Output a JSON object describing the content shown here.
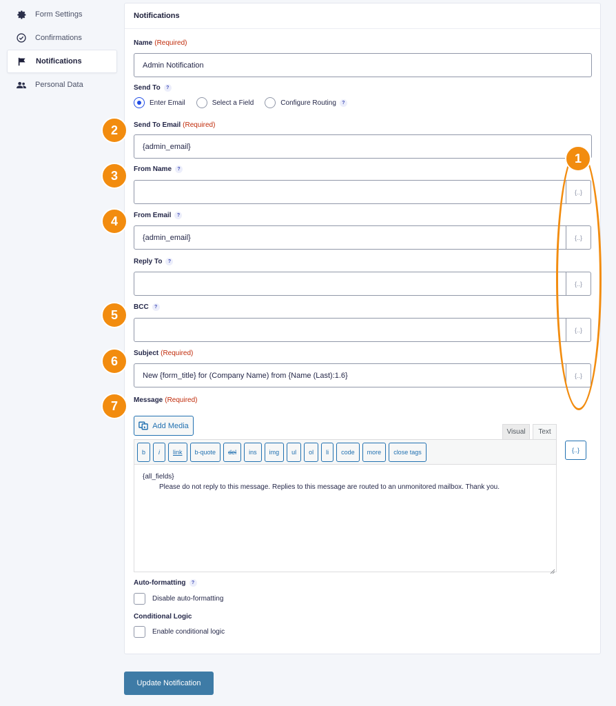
{
  "sidebar": {
    "items": [
      {
        "label": "Form Settings",
        "icon": "gear-icon"
      },
      {
        "label": "Confirmations",
        "icon": "check-circle-icon"
      },
      {
        "label": "Notifications",
        "icon": "flag-icon",
        "active": true
      },
      {
        "label": "Personal Data",
        "icon": "users-icon"
      }
    ]
  },
  "panel": {
    "title": "Notifications",
    "help_glyph": "?",
    "merge_glyph": "{..}",
    "merge_glyph_editor": "{..}",
    "name": {
      "label": "Name",
      "required": "(Required)",
      "value": "Admin Notification"
    },
    "send_to": {
      "label": "Send To",
      "options": [
        "Enter Email",
        "Select a Field",
        "Configure Routing"
      ],
      "selected": "Enter Email"
    },
    "send_to_email": {
      "label": "Send To Email",
      "required": "(Required)",
      "value": "{admin_email}"
    },
    "from_name": {
      "label": "From Name",
      "value": ""
    },
    "from_email": {
      "label": "From Email",
      "value": "{admin_email}"
    },
    "reply_to": {
      "label": "Reply To",
      "value": ""
    },
    "bcc": {
      "label": "BCC",
      "value": ""
    },
    "subject": {
      "label": "Subject",
      "required": "(Required)",
      "value": "New {form_title} for (Company Name) from {Name (Last):1.6}"
    },
    "message": {
      "label": "Message",
      "required": "(Required)",
      "add_media": "Add Media",
      "tabs": {
        "visual": "Visual",
        "text": "Text"
      },
      "quicktags": [
        "b",
        "i",
        "link",
        "b-quote",
        "del",
        "ins",
        "img",
        "ul",
        "ol",
        "li",
        "code",
        "more",
        "close tags"
      ],
      "line1": "{all_fields}",
      "line2": "Please do not reply to this message. Replies to this message are routed to an unmonitored mailbox. Thank you."
    },
    "auto_formatting": {
      "label": "Auto-formatting",
      "checkbox": "Disable auto-formatting"
    },
    "conditional_logic": {
      "label": "Conditional Logic",
      "checkbox": "Enable conditional logic"
    }
  },
  "update_button": "Update Notification",
  "annotations": [
    "1",
    "2",
    "3",
    "4",
    "5",
    "6",
    "7"
  ],
  "colors": {
    "accent": "#f28c0f",
    "required": "#c02b0a",
    "button": "#3e7ba6",
    "link": "#2271b1"
  }
}
